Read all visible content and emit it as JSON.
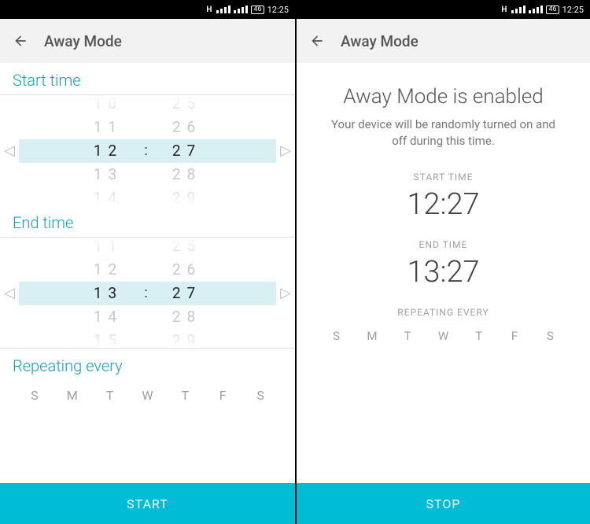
{
  "status": {
    "time": "12:25",
    "battery": "46",
    "carrier_mark": "H"
  },
  "left": {
    "title": "Away Mode",
    "start_label": "Start time",
    "end_label": "End time",
    "repeat_label": "Repeating every",
    "cta": "START",
    "days": [
      "S",
      "M",
      "T",
      "W",
      "T",
      "F",
      "S"
    ],
    "start_picker": {
      "hours": [
        "10",
        "11",
        "12",
        "13",
        "14"
      ],
      "minutes": [
        "25",
        "26",
        "27",
        "28",
        "29"
      ],
      "selected_hour": "12",
      "selected_minute": "27"
    },
    "end_picker": {
      "hours": [
        "11",
        "12",
        "13",
        "14",
        "15"
      ],
      "minutes": [
        "25",
        "26",
        "27",
        "28",
        "29"
      ],
      "selected_hour": "13",
      "selected_minute": "27"
    },
    "separator": ":"
  },
  "right": {
    "title": "Away Mode",
    "heading": "Away Mode is enabled",
    "subtext": "Your device will be randomly turned on and off during this time.",
    "start_label": "START TIME",
    "start_time": "12:27",
    "end_label": "END TIME",
    "end_time": "13:27",
    "repeat_label": "REPEATING EVERY",
    "days": [
      "S",
      "M",
      "T",
      "W",
      "T",
      "F",
      "S"
    ],
    "cta": "STOP"
  }
}
